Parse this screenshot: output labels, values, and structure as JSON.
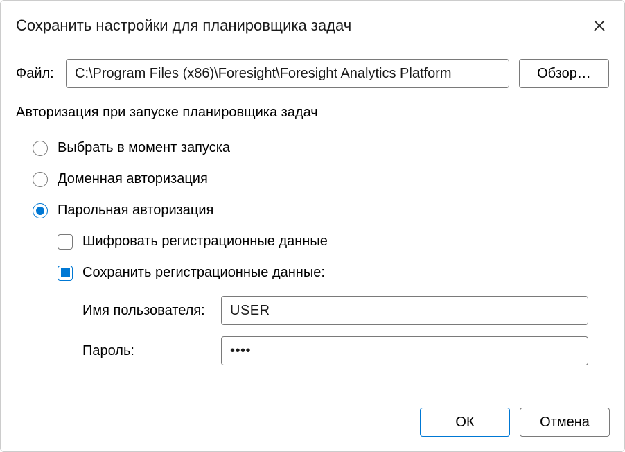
{
  "dialog": {
    "title": "Сохранить настройки для планировщика задач"
  },
  "file": {
    "label": "Файл:",
    "path": "C:\\Program Files (x86)\\Foresight\\Foresight Analytics Platform",
    "browse_label": "Обзор…"
  },
  "auth": {
    "section_label": "Авторизация при запуске планировщика задач",
    "radios": {
      "at_launch": {
        "label": "Выбрать в момент запуска",
        "checked": false
      },
      "domain": {
        "label": "Доменная авторизация",
        "checked": false
      },
      "password": {
        "label": "Парольная авторизация",
        "checked": true
      }
    },
    "checkboxes": {
      "encrypt": {
        "label": "Шифровать регистрационные данные",
        "checked": false
      },
      "save": {
        "label": "Сохранить регистрационные данные:",
        "checked": true
      }
    },
    "credentials": {
      "username_label": "Имя пользователя:",
      "username_value": "USER",
      "password_label": "Пароль:",
      "password_value": "••••"
    }
  },
  "footer": {
    "ok_label": "ОК",
    "cancel_label": "Отмена"
  }
}
